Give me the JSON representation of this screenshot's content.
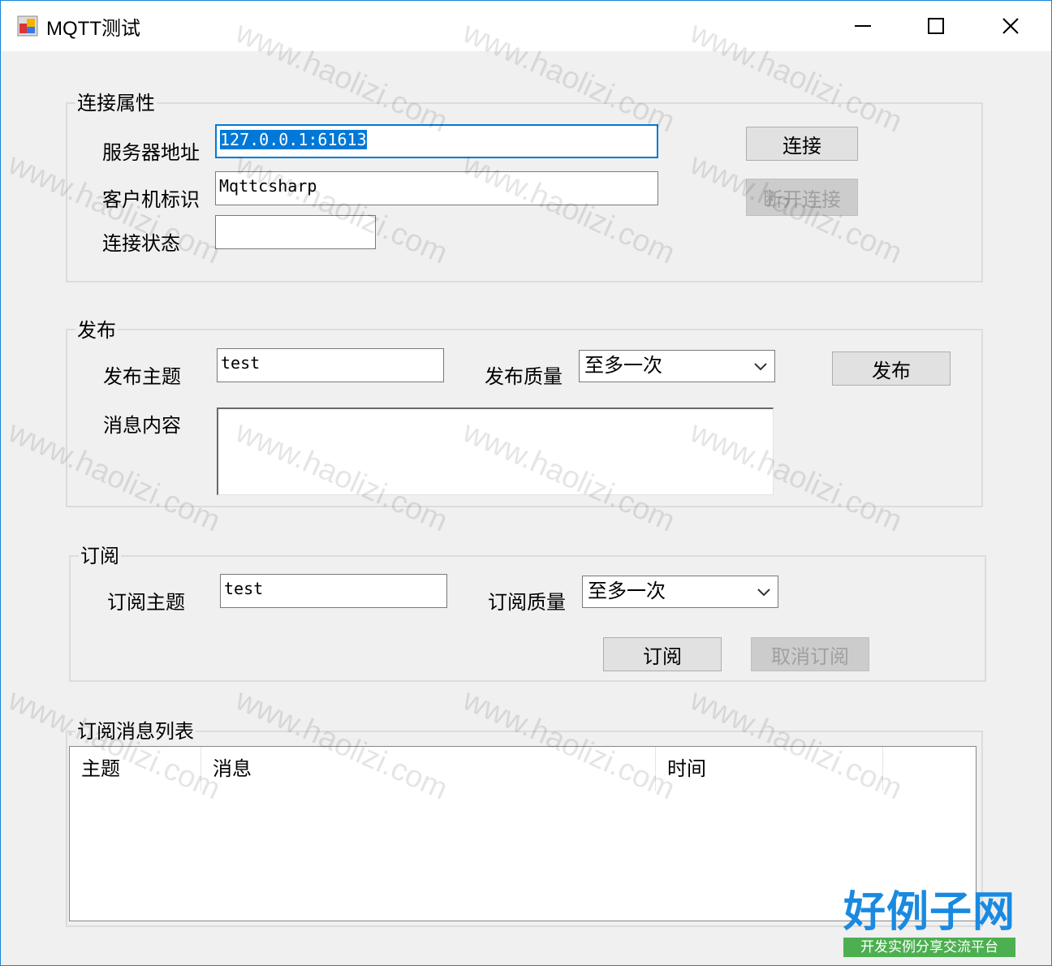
{
  "window": {
    "title": "MQTT测试"
  },
  "connection": {
    "group_title": "连接属性",
    "server_label": "服务器地址",
    "server_value": "127.0.0.1:61613",
    "client_label": "客户机标识",
    "client_value": "Mqttcsharp",
    "status_label": "连接状态",
    "status_value": "",
    "connect_button": "连接",
    "disconnect_button": "断开连接"
  },
  "publish": {
    "group_title": "发布",
    "topic_label": "发布主题",
    "topic_value": "test",
    "qos_label": "发布质量",
    "qos_value": "至多一次",
    "message_label": "消息内容",
    "message_value": "",
    "publish_button": "发布"
  },
  "subscribe": {
    "group_title": "订阅",
    "topic_label": "订阅主题",
    "topic_value": "test",
    "qos_label": "订阅质量",
    "qos_value": "至多一次",
    "subscribe_button": "订阅",
    "unsubscribe_button": "取消订阅"
  },
  "messages": {
    "group_title": "订阅消息列表",
    "columns": [
      "主题",
      "消息",
      "时间"
    ]
  },
  "watermark": {
    "text": "www.haolizi.com",
    "logo_title": "好例子网",
    "logo_subtitle": "开发实例分享交流平台"
  },
  "colors": {
    "focus_border": "#0078d7",
    "selection": "#0078d7",
    "logo_blue": "#1a8ae0",
    "logo_green": "#4caf50"
  }
}
